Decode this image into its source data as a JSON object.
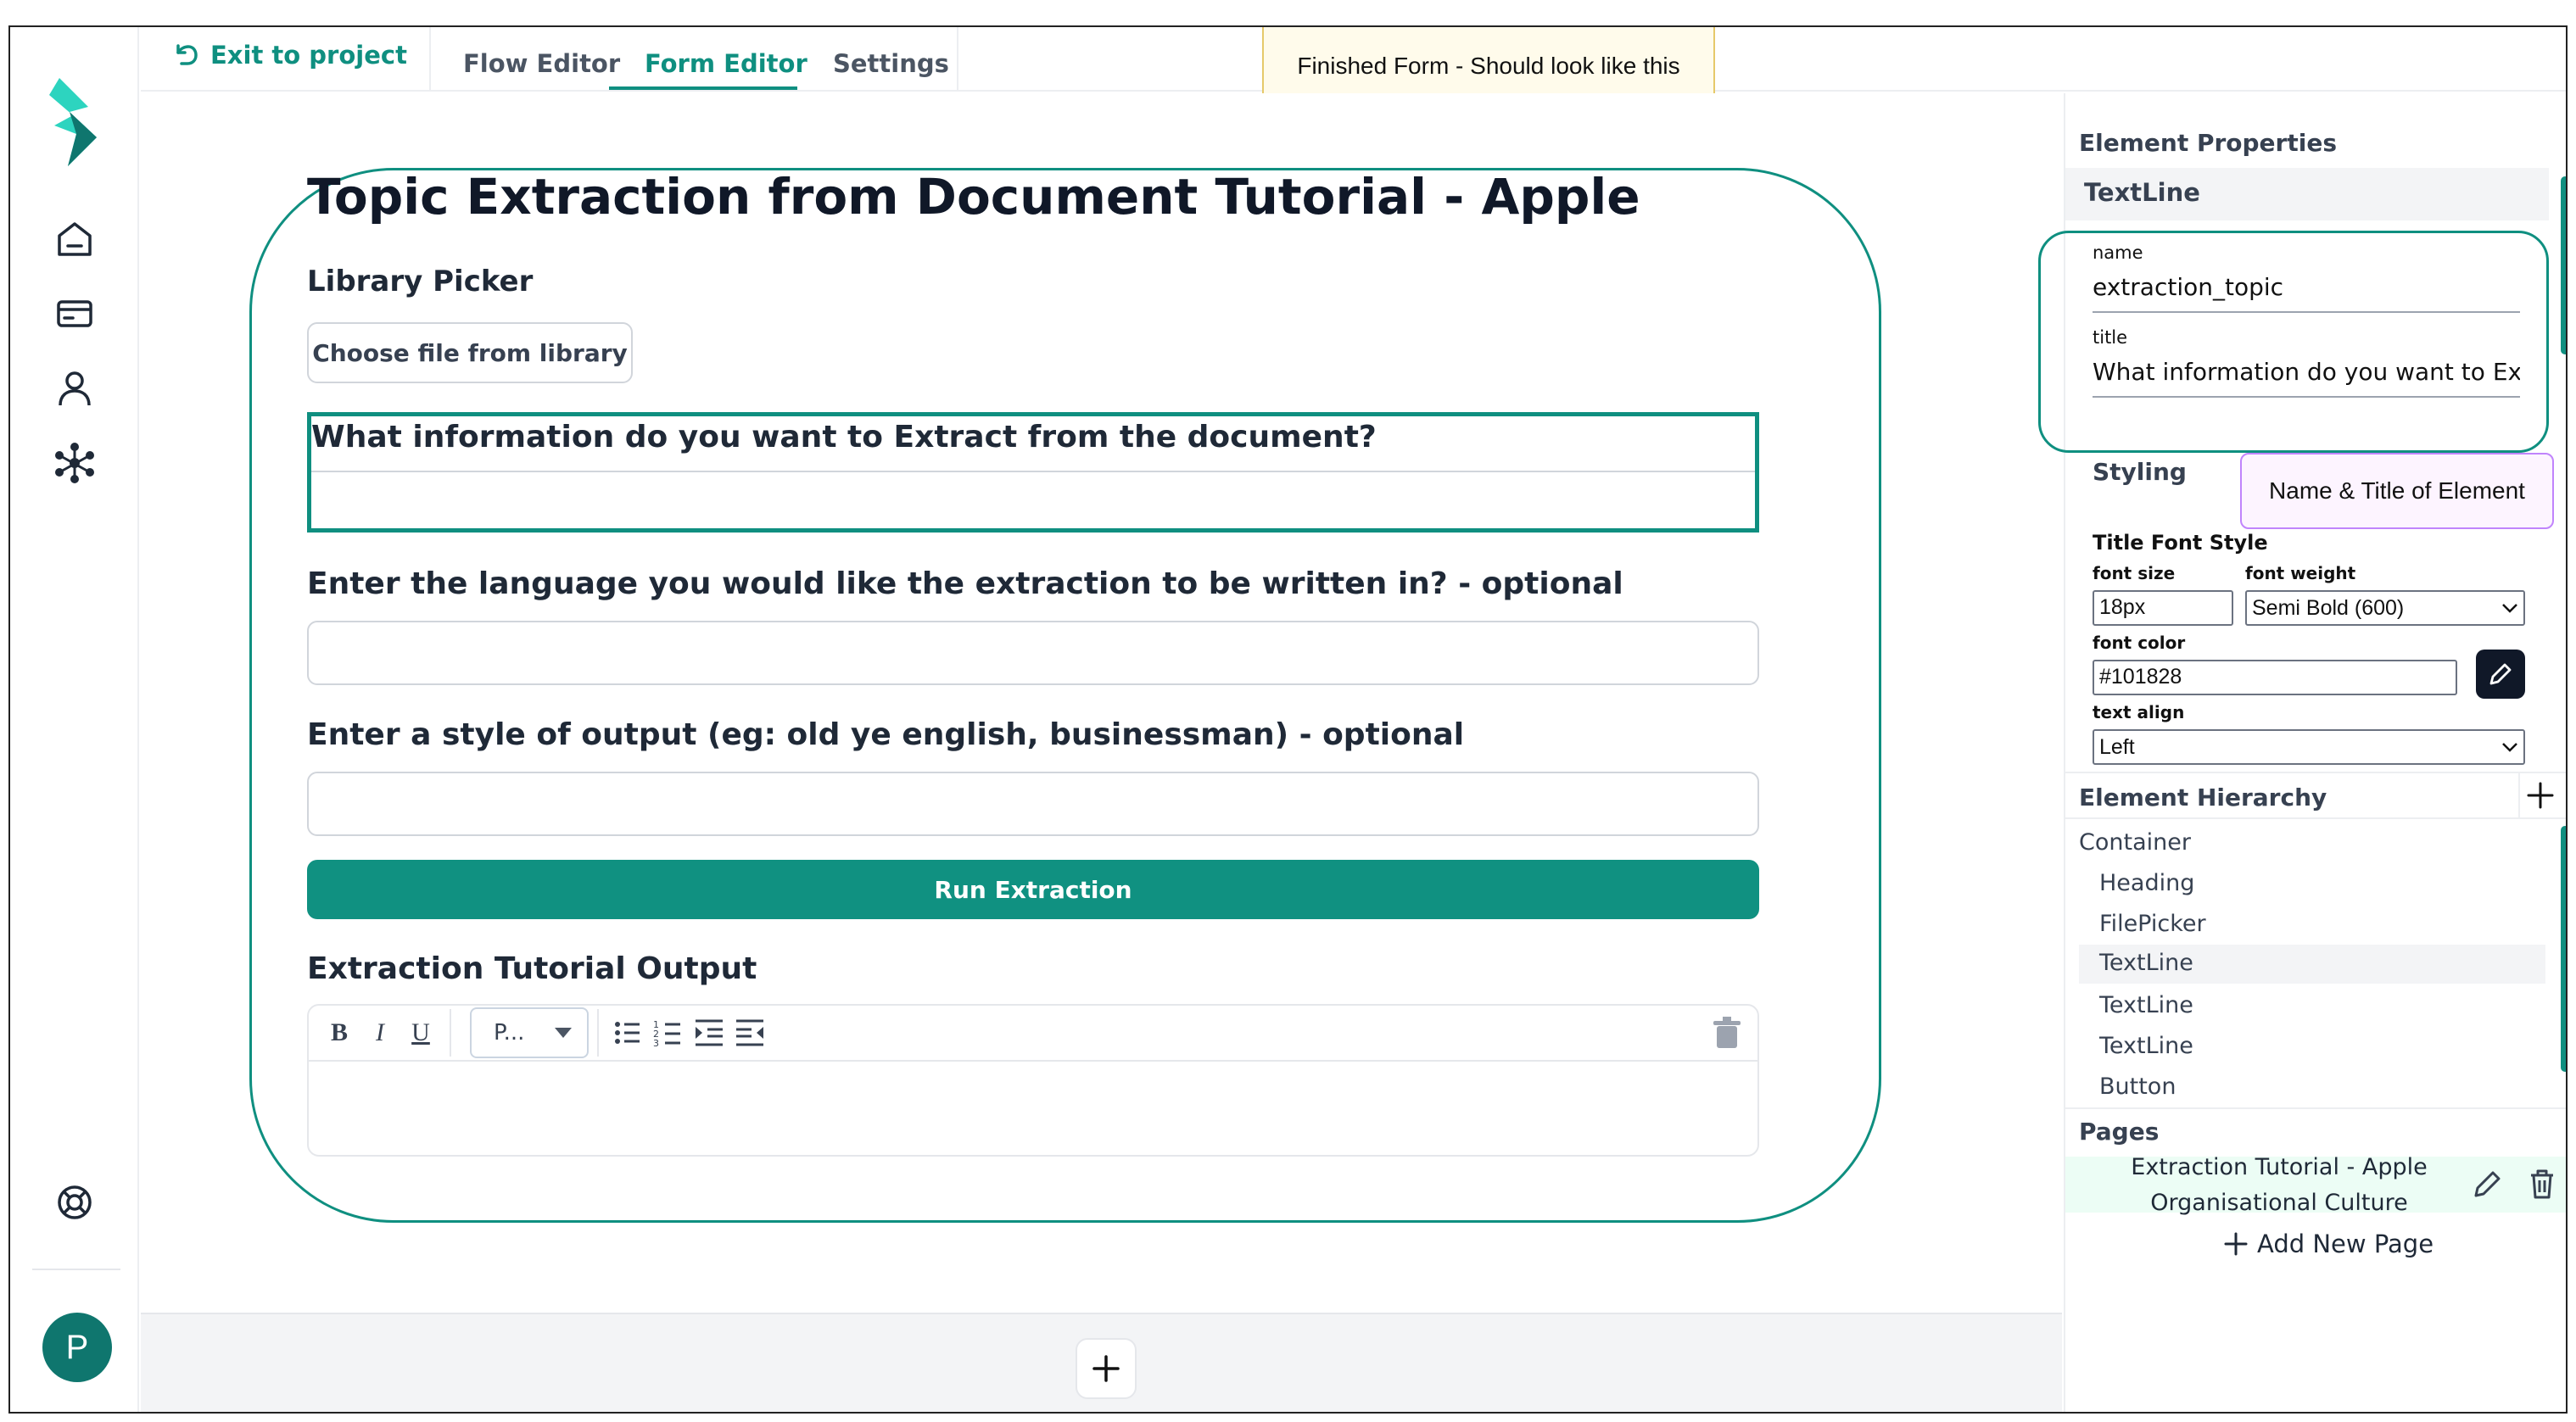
{
  "topbar": {
    "exit_label": "Exit to project",
    "tabs": [
      {
        "label": "Flow Editor"
      },
      {
        "label": "Form Editor"
      },
      {
        "label": "Settings"
      }
    ]
  },
  "annotation_top": "Finished Form - Should look like this",
  "annotation_right": "Name & Title of Element",
  "form": {
    "title": "Topic Extraction from Document Tutorial - Apple",
    "library_label": "Library Picker",
    "file_button": "Choose file from library",
    "q1": "What information do you want to Extract from the document?",
    "q2": "Enter the language you would like the extraction to be written in? - optional",
    "q3": "Enter a style of output (eg: old ye english, businessman) - optional",
    "run_button": "Run Extraction",
    "output_label": "Extraction Tutorial Output",
    "editor": {
      "bold": "B",
      "italic": "I",
      "underline": "U",
      "paragraph_select": "P..."
    }
  },
  "panel": {
    "title": "Element Properties",
    "element_type": "TextLine",
    "name_label": "name",
    "name_value": "extraction_topic",
    "title_label": "title",
    "title_value": "What information do you want to Extract from the document?",
    "styling": "Styling",
    "title_font_style": "Title Font Style",
    "font_size_label": "font size",
    "font_size_value": "18px",
    "font_weight_label": "font weight",
    "font_weight_value": "Semi Bold (600)",
    "font_color_label": "font color",
    "font_color_value": "#101828",
    "text_align_label": "text align",
    "text_align_value": "Left",
    "hierarchy_title": "Element Hierarchy",
    "hierarchy": [
      {
        "label": "Container"
      },
      {
        "label": "Heading"
      },
      {
        "label": "FilePicker"
      },
      {
        "label": "TextLine"
      },
      {
        "label": "TextLine"
      },
      {
        "label": "TextLine"
      },
      {
        "label": "Button"
      }
    ],
    "pages_title": "Pages",
    "page_name_line1": "Extraction Tutorial - Apple",
    "page_name_line2": "Organisational Culture",
    "add_page": "Add New Page"
  },
  "user": {
    "avatar_initial": "P"
  },
  "colors": {
    "accent": "#0f8f80",
    "primary_button": "#109181",
    "text": "#101828"
  }
}
